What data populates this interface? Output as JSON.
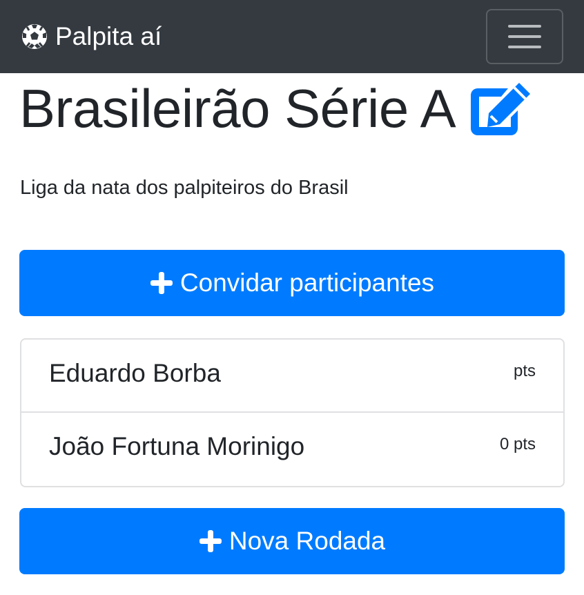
{
  "navbar": {
    "brand_label": "Palpita aí",
    "brand_icon": "soccer-ball-icon",
    "toggle_icon": "hamburger-menu-icon"
  },
  "league": {
    "title": "Brasileirão Série A",
    "edit_icon": "edit-icon",
    "description": "Liga da nata dos palpiteiros do Brasil"
  },
  "actions": {
    "invite_label": "Convidar participantes",
    "new_round_label": "Nova Rodada"
  },
  "participants": [
    {
      "name": "Eduardo Borba",
      "points": "pts"
    },
    {
      "name": "João Fortuna Morinigo",
      "points": "0 pts"
    }
  ],
  "colors": {
    "navbar_bg": "#343a40",
    "primary": "#007bff",
    "text": "#212529"
  }
}
